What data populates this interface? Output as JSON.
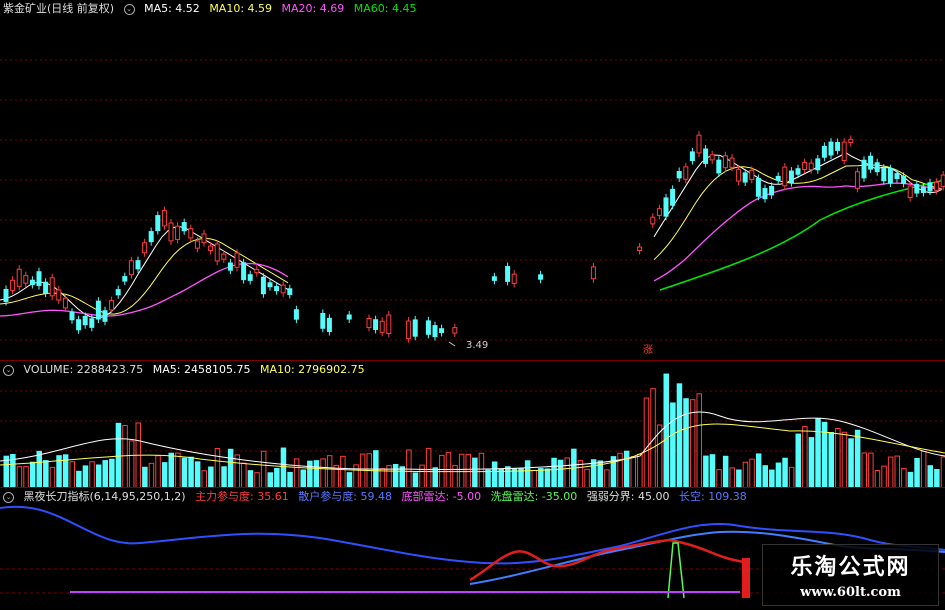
{
  "price": {
    "stock_name": "紫金矿业(日线 前复权)",
    "ma5": "MA5: 4.52",
    "ma10": "MA10: 4.59",
    "ma20": "MA20: 4.69",
    "ma60": "MA60: 4.45",
    "low_label": "3.49",
    "marker": "涨"
  },
  "volume": {
    "label": "VOLUME: 2288423.75",
    "ma5": "MA5: 2458105.75",
    "ma10": "MA10: 2796902.75"
  },
  "indicator": {
    "name": "黑夜长刀指标(6,14,95,250,1,2)",
    "main_force": "主力参与度: 35.61",
    "retail": "散户参与度: 59.48",
    "bottom_radar": "底部雷达: -5.00",
    "wash_radar": "洗盘雷达: -35.00",
    "strength": "强弱分界: 45.00",
    "bearish": "长空: 109.38"
  },
  "watermark": {
    "title": "乐淘公式网",
    "url": "www.60lt.com"
  },
  "colors": {
    "up": "#ff3c3c",
    "down": "#54fcfc",
    "ma5": "#ffffff",
    "ma10": "#ffff54",
    "ma20": "#ff54ff",
    "ma60": "#00e600",
    "grid": "#7a0000",
    "blue": "#3050ff"
  }
}
